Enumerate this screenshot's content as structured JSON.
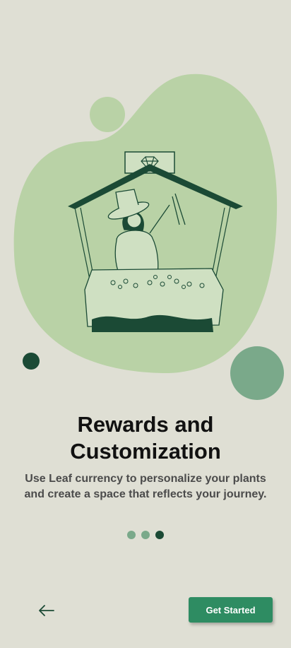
{
  "onboarding": {
    "title_line1": "Rewards and",
    "title_line2": "Customization",
    "description": "Use Leaf currency to personalize your plants and create a space that reflects your journey.",
    "page_indicator": {
      "total": 3,
      "active": 3
    },
    "back_icon": "arrow-left-icon",
    "cta_label": "Get Started"
  },
  "colors": {
    "background": "#dfdfd4",
    "blob": "#b9d2a6",
    "accent_dark": "#1b4a35",
    "accent_mid": "#7aa98a",
    "cta": "#2e8c62"
  }
}
